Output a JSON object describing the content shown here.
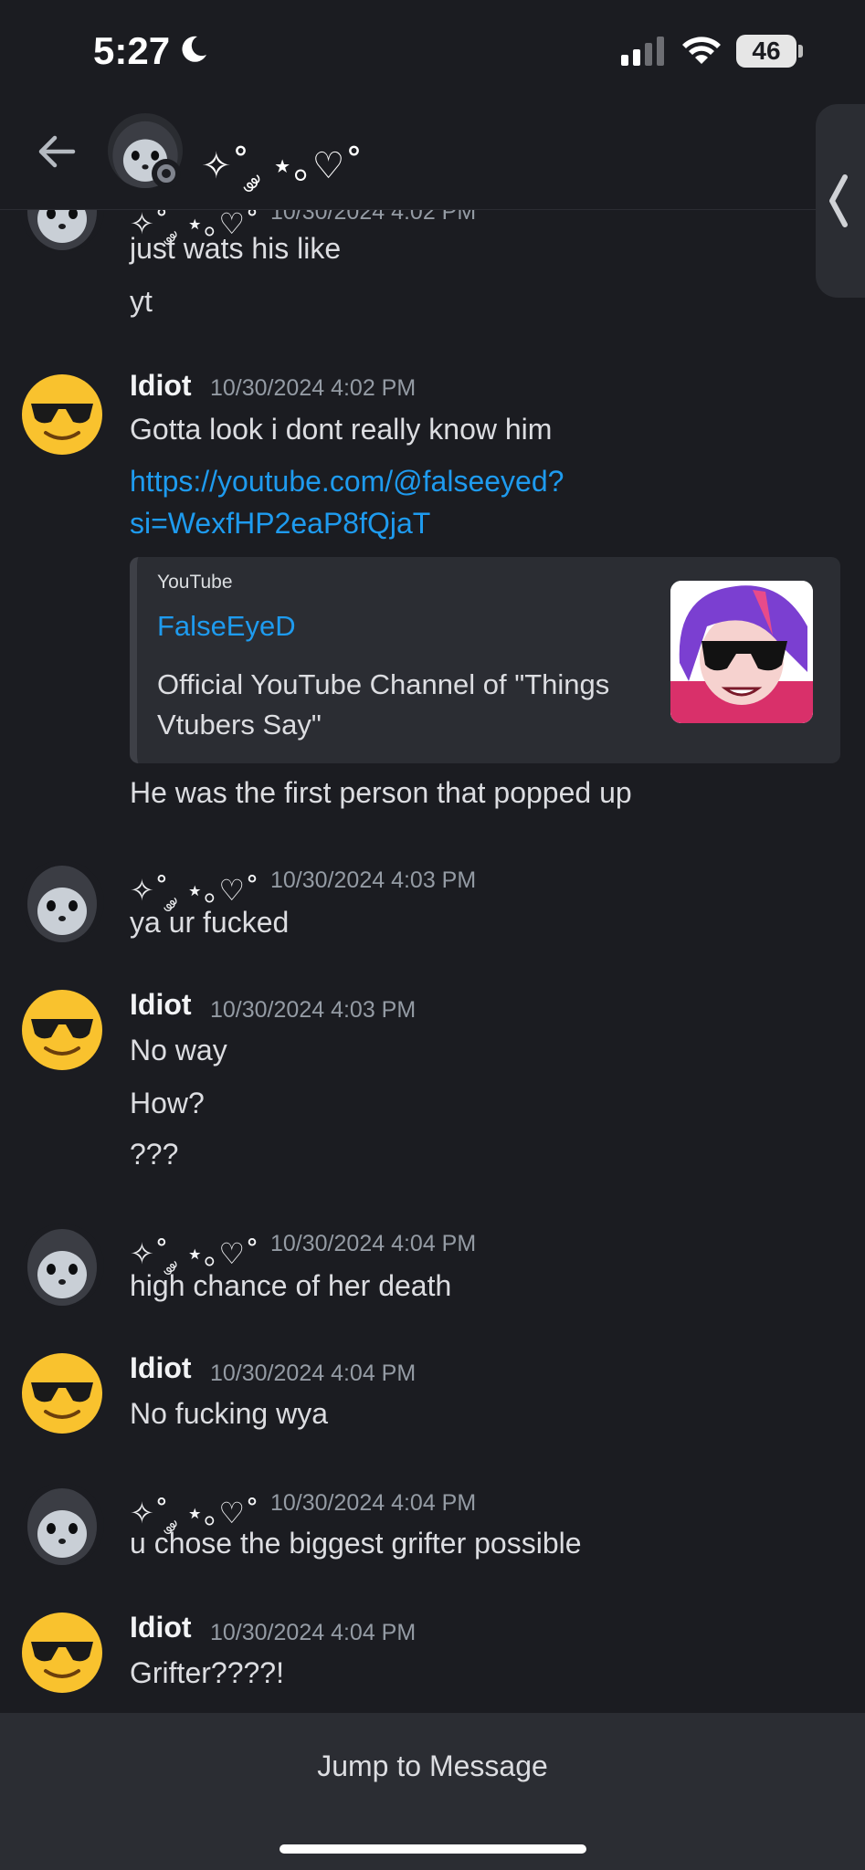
{
  "status_bar": {
    "time": "5:27",
    "battery": "46"
  },
  "header": {
    "channel_name": "✧˚ ༘ ⋆｡♡˚"
  },
  "messages": [
    {
      "author": "✧˚ ༘ ⋆｡♡˚",
      "timestamp": "10/30/2024 4:02 PM",
      "lines": [
        "just wats his like",
        "yt"
      ]
    },
    {
      "author": "Idiot",
      "timestamp": "10/30/2024 4:02 PM",
      "lines": [
        "Gotta look i dont really know him"
      ],
      "link": [
        "https://youtube.com/@falseeyed?",
        "si=WexfHP2eaP8fQjaT"
      ],
      "embed": {
        "provider": "YouTube",
        "title": "FalseEyeD",
        "description": "Official YouTube Channel of \"Things Vtubers Say\""
      },
      "after": "He was the first person that popped up"
    },
    {
      "author": "✧˚ ༘ ⋆｡♡˚",
      "timestamp": "10/30/2024 4:03 PM",
      "lines": [
        "ya ur fucked"
      ]
    },
    {
      "author": "Idiot",
      "timestamp": "10/30/2024 4:03 PM",
      "lines": [
        "No way",
        "How?",
        "???"
      ]
    },
    {
      "author": "✧˚ ༘ ⋆｡♡˚",
      "timestamp": "10/30/2024 4:04 PM",
      "lines": [
        "high chance of her death"
      ]
    },
    {
      "author": "Idiot",
      "timestamp": "10/30/2024 4:04 PM",
      "lines": [
        "No fucking wya"
      ]
    },
    {
      "author": "✧˚ ༘ ⋆｡♡˚",
      "timestamp": "10/30/2024 4:04 PM",
      "lines": [
        "u chose the biggest grifter possible"
      ]
    },
    {
      "author": "Idiot",
      "timestamp": "10/30/2024 4:04 PM",
      "lines": [
        "Grifter????!"
      ]
    }
  ],
  "footer": {
    "jump_label": "Jump to Message"
  },
  "icons": [
    "back-arrow-icon",
    "moon-icon",
    "signal-icon",
    "wifi-icon",
    "battery-icon",
    "chevron-left-icon",
    "seal-avatar",
    "sunglasses-emoji-avatar"
  ]
}
